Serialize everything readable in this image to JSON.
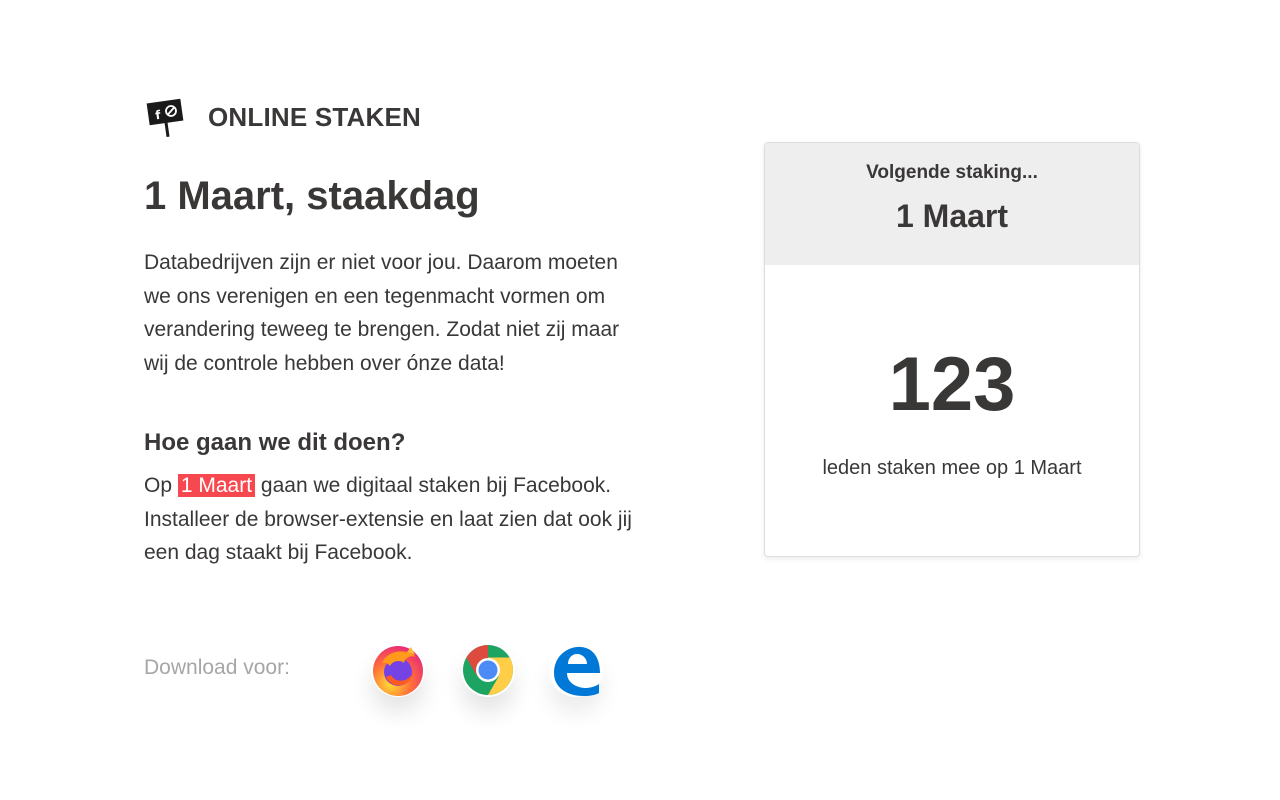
{
  "brand": {
    "name": "ONLINE STAKEN",
    "logo_icon": "strike-sign-icon"
  },
  "hero": {
    "title": "1 Maart, staakdag",
    "intro": "Databedrijven zijn er niet voor jou. Daarom moeten we ons verenigen en een tegenmacht vormen om verandering teweeg te brengen. Zodat niet zij maar wij de controle hebben over ónze data!"
  },
  "howto": {
    "heading": "Hoe gaan we dit doen?",
    "prefix": "Op",
    "highlight": "1 Maart",
    "rest": "gaan we digitaal staken bij Facebook. Installeer de browser-extensie en laat zien dat ook jij een dag staakt bij Facebook."
  },
  "download": {
    "label": "Download voor:",
    "browsers": [
      {
        "name": "firefox-icon"
      },
      {
        "name": "chrome-icon"
      },
      {
        "name": "edge-icon"
      }
    ]
  },
  "strike_card": {
    "kicker": "Volgende staking...",
    "date": "1 Maart",
    "count": "123",
    "caption": "leden staken mee op 1 Maart"
  },
  "colors": {
    "text": "#3a3737",
    "highlight": "#f7474f",
    "muted": "#a6a6a6",
    "card_header": "#eeeeee"
  }
}
